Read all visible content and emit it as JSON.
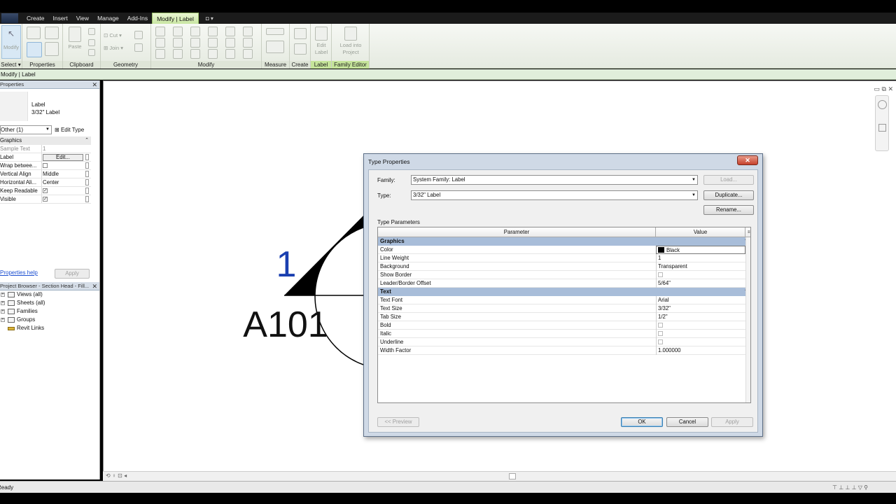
{
  "menu": {
    "tabs": [
      "Create",
      "Insert",
      "View",
      "Manage",
      "Add-Ins",
      "Modify | Label"
    ],
    "active_index": 5
  },
  "ribbon": {
    "panels": [
      "Select",
      "Properties",
      "Clipboard",
      "Geometry",
      "Modify",
      "Measure",
      "Create",
      "Label",
      "Family Editor"
    ],
    "select_dropdown": "Select ▾",
    "modify_button": "Modify",
    "paste_button": "Paste",
    "cut_label": "Cut",
    "join_label": "Join",
    "edit_label_button": "Edit Label",
    "load_into_project_button": "Load into Project"
  },
  "options_bar": {
    "context": "Modify | Label"
  },
  "properties_palette": {
    "title": "Properties",
    "type_name": "Label",
    "type_sub": "3/32\" Label",
    "filter": "Other (1)",
    "edit_type": "Edit Type",
    "group": "Graphics",
    "rows": [
      {
        "name": "Sample Text",
        "value": "1",
        "kind": "text",
        "greyed": true
      },
      {
        "name": "Label",
        "value": "Edit...",
        "kind": "button"
      },
      {
        "name": "Wrap betwee...",
        "value": "",
        "kind": "check",
        "checked": false
      },
      {
        "name": "Vertical Align",
        "value": "Middle",
        "kind": "text"
      },
      {
        "name": "Horizontal Ali...",
        "value": "Center",
        "kind": "text"
      },
      {
        "name": "Keep Readable",
        "value": "",
        "kind": "check",
        "checked": true
      },
      {
        "name": "Visible",
        "value": "",
        "kind": "check",
        "checked": true
      }
    ],
    "help_link": "Properties help",
    "apply_button": "Apply"
  },
  "project_browser": {
    "title": "Project Browser - Section Head - Fill...",
    "items": [
      "Views (all)",
      "Sheets (all)",
      "Families",
      "Groups",
      "Revit Links"
    ]
  },
  "canvas": {
    "upper_text": "1",
    "lower_text": "A101"
  },
  "status_bar": {
    "text": "Ready"
  },
  "dialog": {
    "title": "Type Properties",
    "family_label": "Family:",
    "family_value": "System Family: Label",
    "type_label": "Type:",
    "type_value": "3/32\" Label",
    "load_button": "Load...",
    "duplicate_button": "Duplicate...",
    "rename_button": "Rename...",
    "section_label": "Type Parameters",
    "col_parameter": "Parameter",
    "col_value": "Value",
    "groups": [
      {
        "name": "Graphics",
        "rows": [
          {
            "param": "Color",
            "value": "Black",
            "kind": "color",
            "color": "#000000"
          },
          {
            "param": "Line Weight",
            "value": "1",
            "kind": "text"
          },
          {
            "param": "Background",
            "value": "Transparent",
            "kind": "text"
          },
          {
            "param": "Show Border",
            "value": "",
            "kind": "check"
          },
          {
            "param": "Leader/Border Offset",
            "value": "5/64\"",
            "kind": "text"
          }
        ]
      },
      {
        "name": "Text",
        "rows": [
          {
            "param": "Text Font",
            "value": "Arial",
            "kind": "text"
          },
          {
            "param": "Text Size",
            "value": "3/32\"",
            "kind": "text"
          },
          {
            "param": "Tab Size",
            "value": "1/2\"",
            "kind": "text"
          },
          {
            "param": "Bold",
            "value": "",
            "kind": "check"
          },
          {
            "param": "Italic",
            "value": "",
            "kind": "check"
          },
          {
            "param": "Underline",
            "value": "",
            "kind": "check"
          },
          {
            "param": "Width Factor",
            "value": "1.000000",
            "kind": "text"
          }
        ]
      }
    ],
    "preview_button": "<< Preview",
    "ok_button": "OK",
    "cancel_button": "Cancel",
    "apply_button": "Apply"
  },
  "colors": {
    "accent_green": "#c5e49a",
    "group_header": "#a8bdd9",
    "label_blue": "#1a3fb0"
  }
}
